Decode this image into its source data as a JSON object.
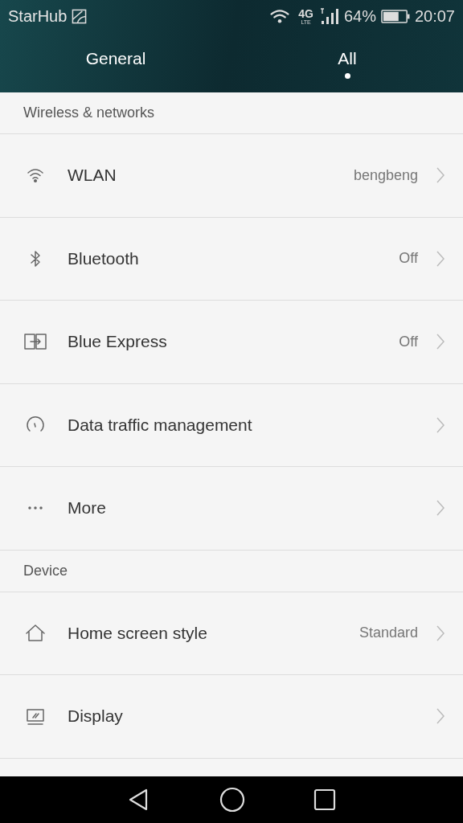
{
  "status_bar": {
    "carrier": "StarHub",
    "network": "4G",
    "network_sub": "LTE",
    "battery": "64%",
    "time": "20:07"
  },
  "tabs": [
    {
      "label": "General",
      "selected": false
    },
    {
      "label": "All",
      "selected": true
    }
  ],
  "sections": [
    {
      "title": "Wireless & networks",
      "items": [
        {
          "kind": "wifi",
          "label": "WLAN",
          "value": "bengbeng"
        },
        {
          "kind": "bluetooth",
          "label": "Bluetooth",
          "value": "Off"
        },
        {
          "kind": "transfer",
          "label": "Blue Express",
          "value": "Off"
        },
        {
          "kind": "gauge",
          "label": "Data traffic management"
        },
        {
          "kind": "dots",
          "label": "More"
        }
      ]
    },
    {
      "title": "Device",
      "items": [
        {
          "kind": "home",
          "label": "Home screen style",
          "value": "Standard"
        },
        {
          "kind": "display",
          "label": "Display"
        }
      ]
    }
  ]
}
